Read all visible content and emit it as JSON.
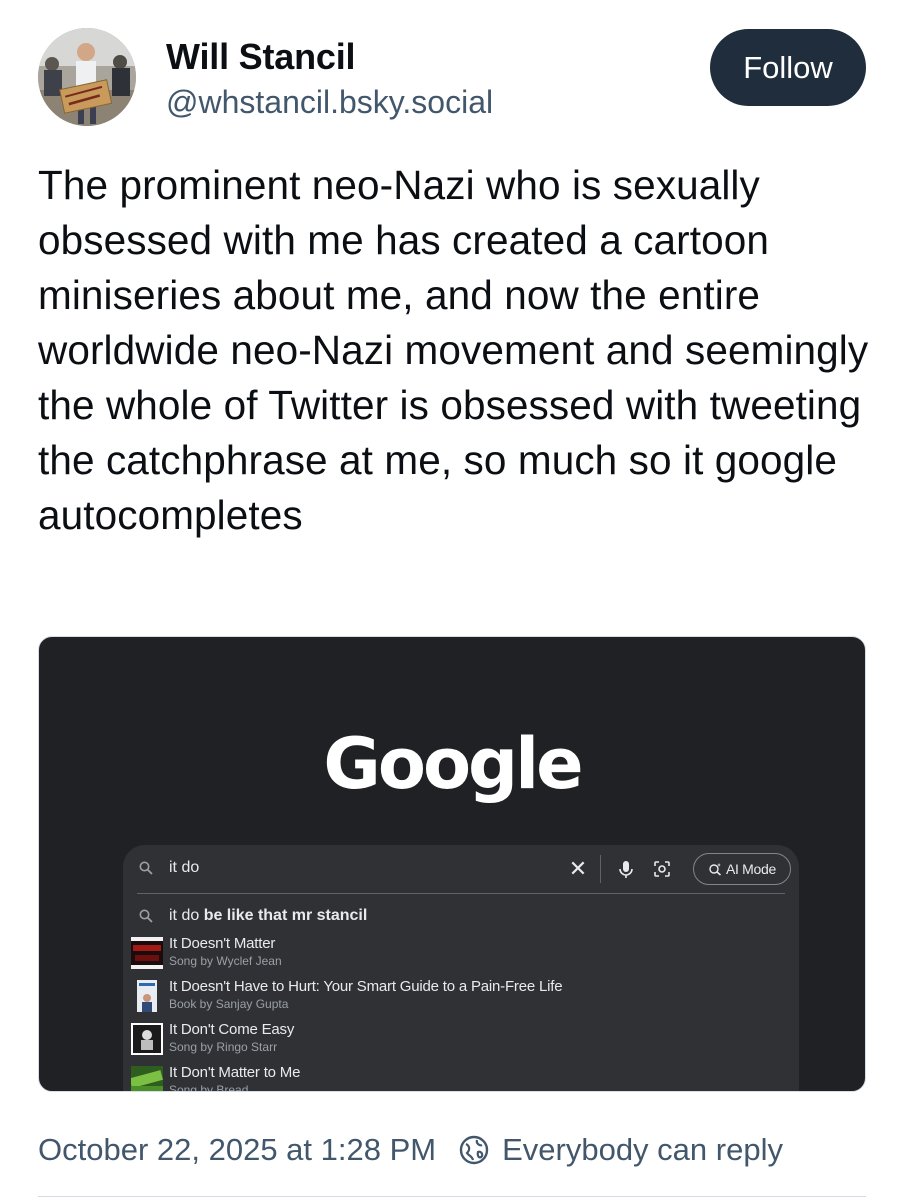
{
  "author": {
    "display_name": "Will Stancil",
    "handle": "@whstancil.bsky.social",
    "avatar_sign_text": "Bring them BACK!"
  },
  "follow_button": {
    "label": "Follow",
    "color": "#1f2d3d"
  },
  "post": {
    "text": "The prominent neo-Nazi who is sexually obsessed with me has created a cartoon miniseries about me, and now the entire worldwide neo-Nazi movement and seemingly the whole of Twitter is obsessed with tweeting the catchphrase at me, so much so it google autocompletes",
    "timestamp": "October 22, 2025 at 1:28 PM",
    "reply_setting": "Everybody can reply"
  },
  "embedded_image": {
    "logo_text": "Google",
    "search_query": "it do",
    "ai_mode_label": "AI Mode",
    "top_suggestion": {
      "prefix": "it do ",
      "completion": "be like that mr stancil"
    },
    "suggestions": [
      {
        "title": "It Doesn't Matter",
        "subtitle": "Song by Wyclef Jean"
      },
      {
        "title": "It Doesn't Have to Hurt: Your Smart Guide to a Pain-Free Life",
        "subtitle": "Book by Sanjay Gupta"
      },
      {
        "title": "It Don't Come Easy",
        "subtitle": "Song by Ringo Starr"
      },
      {
        "title": "It Don't Matter to Me",
        "subtitle": "Song by Bread"
      }
    ]
  },
  "icons": {
    "search": "search-icon",
    "clear": "close-icon",
    "mic": "mic-icon",
    "lens": "lens-icon",
    "ai_mode": "ai-sparkle-search-icon",
    "reply_setting": "globe-icon"
  }
}
